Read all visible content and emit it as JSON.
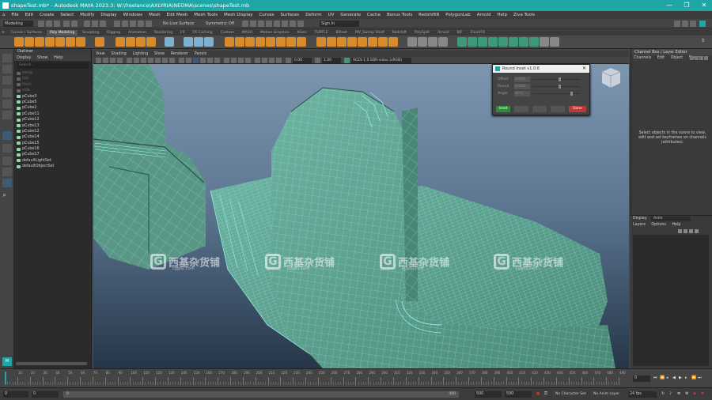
{
  "window": {
    "title": "shapeTest.mb* - Autodesk MAYA 2023.3: W:\\freelance\\AXLYRIA\\NEOMA\\scenes\\shapeTest.mb",
    "controls": [
      "—",
      "❐",
      "✕"
    ]
  },
  "menubar": [
    "File",
    "Edit",
    "Create",
    "Select",
    "Modify",
    "Display",
    "Windows",
    "Mesh",
    "Edit Mesh",
    "Mesh Tools",
    "Mesh Display",
    "Curves",
    "Surfaces",
    "Deform",
    "UV",
    "Generate",
    "Cache",
    "Bonus Tools",
    "RedshiftR",
    "PolygonLab",
    "Arnold",
    "Help",
    "Ziva Tools"
  ],
  "statusline": {
    "mode": "Modeling",
    "no_live_surface": "No Live Surface",
    "symmetry": "Symmetry: Off",
    "sign_in": "Sign In"
  },
  "shelf_tabs": [
    "Curves / Surfaces",
    "Poly Modeling",
    "Sculpting",
    "Rigging",
    "Animation",
    "Rendering",
    "FX",
    "FX Caching",
    "Custom",
    "MASH",
    "Motion Graphics",
    "XGen",
    "TURTLE",
    "Bifrost",
    "MV_Sweep Shelf",
    "Redshift",
    "PolySplit",
    "Arnold",
    "BIF",
    "ZivaVFX"
  ],
  "active_shelf_tab": "Poly Modeling",
  "outliner": {
    "title": "Outliner",
    "menu": [
      "Display",
      "Show",
      "Help"
    ],
    "search_placeholder": "Search...",
    "items": [
      {
        "label": "persp",
        "dim": true
      },
      {
        "label": "top",
        "dim": true
      },
      {
        "label": "front",
        "dim": true
      },
      {
        "label": "side",
        "dim": true
      },
      {
        "label": "pCube3",
        "dim": false
      },
      {
        "label": "pCube5",
        "dim": false
      },
      {
        "label": "pCube2",
        "dim": false
      },
      {
        "label": "pCube11",
        "dim": false
      },
      {
        "label": "pCube12",
        "dim": false
      },
      {
        "label": "pCube13",
        "dim": false
      },
      {
        "label": "pCube12",
        "dim": false
      },
      {
        "label": "pCube14",
        "dim": false
      },
      {
        "label": "pCube15",
        "dim": false
      },
      {
        "label": "pCube16",
        "dim": false
      },
      {
        "label": "pCube17",
        "dim": false
      },
      {
        "label": "defaultLightSet",
        "dim": false
      },
      {
        "label": "defaultObjectSet",
        "dim": false
      }
    ]
  },
  "viewport": {
    "menu": [
      "View",
      "Shading",
      "Lighting",
      "Show",
      "Renderer",
      "Panels"
    ],
    "exposure": "0.00",
    "gamma": "1.00",
    "color_space": "ACES 1.0 SDR-video (sRGB)"
  },
  "dialog": {
    "title": "Round Inset v1.0.6",
    "fields": [
      {
        "label": "Offset",
        "value": "0.000",
        "fraction": 0.55
      },
      {
        "label": "Round",
        "value": "0.000",
        "fraction": 0.55
      },
      {
        "label": "Angle",
        "value": "80.0",
        "fraction": 0.8
      }
    ],
    "buttons": {
      "inset": "Inset",
      "b2": "Cancel",
      "b3": "Reset",
      "b4": "Apply",
      "done": "Done"
    }
  },
  "channelbox": {
    "title": "Channel Box / Layer Editor",
    "menu": [
      "Channels",
      "Edit",
      "Object",
      "Show"
    ],
    "message": "Select objects in the scene to view, edit and set keyframes on channels (attributes)."
  },
  "layers": {
    "tabs": [
      "Display",
      "Anim"
    ],
    "menu": [
      "Layers",
      "Options",
      "Help"
    ]
  },
  "timeline": {
    "ticks": [
      "10",
      "20",
      "30",
      "40",
      "50",
      "60",
      "70",
      "80",
      "90",
      "100",
      "110",
      "120",
      "130",
      "140",
      "150",
      "160",
      "170",
      "180",
      "190",
      "200",
      "210",
      "220",
      "230",
      "240",
      "250",
      "260",
      "270",
      "280",
      "290",
      "300",
      "310",
      "320",
      "330",
      "340",
      "350",
      "360",
      "370",
      "380",
      "390",
      "400",
      "410",
      "420",
      "430",
      "440",
      "450",
      "460",
      "470",
      "480",
      "490"
    ],
    "current_frame": "0"
  },
  "range": {
    "start": "0",
    "playback_start": "0",
    "range_left": "0",
    "range_end": "500",
    "end": "500",
    "playback_end": "500",
    "character_set": "No Character Set",
    "anim_layer": "No Anim Layer",
    "fps": "24 fps"
  },
  "watermarks": [
    {
      "cn": "西基杂货铺",
      "sub": "cggou.com"
    },
    {
      "cn": "西基杂货铺",
      "sub": "cggou.com"
    },
    {
      "cn": "西基杂货铺",
      "sub": "cggou.com"
    },
    {
      "cn": "西基杂货铺",
      "sub": "cggou.com"
    }
  ],
  "colors": {
    "titlebar": "#1fa7a7",
    "mesh_fill": "#5c9c8c",
    "mesh_wire": "#8ff0e0",
    "inset_button": "#2e8b3d",
    "done_button": "#b83a3a"
  }
}
